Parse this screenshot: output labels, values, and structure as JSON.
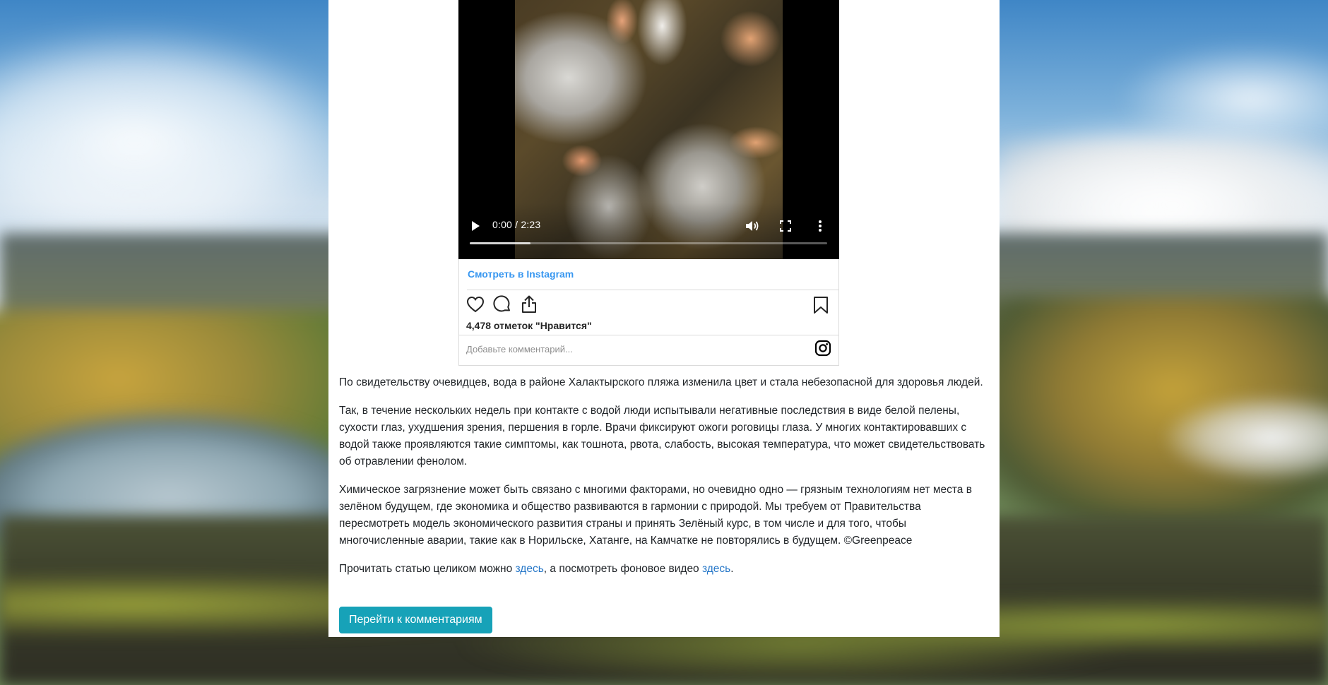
{
  "video": {
    "time": "0:00 / 2:23",
    "progress_buffered_fraction": 0.17
  },
  "instagram": {
    "view_link": "Смотреть в Instagram",
    "likes": "4,478 отметок \"Нравится\"",
    "comment_placeholder": "Добавьте комментарий..."
  },
  "article": {
    "p1": "По свидетельству очевидцев, вода в районе Халактырского пляжа изменила цвет и стала небезопасной для здоровья людей.",
    "p2": "Так, в течение нескольких недель при контакте с водой люди испытывали негативные последствия в виде белой пелены, сухости глаз, ухудшения зрения, першения в горле. Врачи фиксируют ожоги роговицы глаза. У многих контактировавших с водой также проявляются такие симптомы, как тошнота, рвота, слабость, высокая температура, что может свидетельствовать об отравлении фенолом.",
    "p3": "Химическое загрязнение может быть связано с многими факторами, но очевидно одно — грязным технологиям нет места в зелёном будущем, где экономика и общество развиваются в гармонии с природой. Мы требуем от Правительства пересмотреть модель экономического развития страны и принять Зелёный курс, в том числе и для того, чтобы многочисленные аварии, такие как в Норильске, Хатанге, на Камчатке не повторялись в будущем. ©Greenpeace",
    "p4_part1": "Прочитать статью целиком можно ",
    "p4_link1": "здесь",
    "p4_part2": ", а посмотреть фоновое видео ",
    "p4_link2": "здесь",
    "p4_part3": "."
  },
  "comments_button": "Перейти к комментариям",
  "colors": {
    "link": "#2677c8",
    "instagram_link": "#3897f0",
    "button": "#17a2b8"
  }
}
